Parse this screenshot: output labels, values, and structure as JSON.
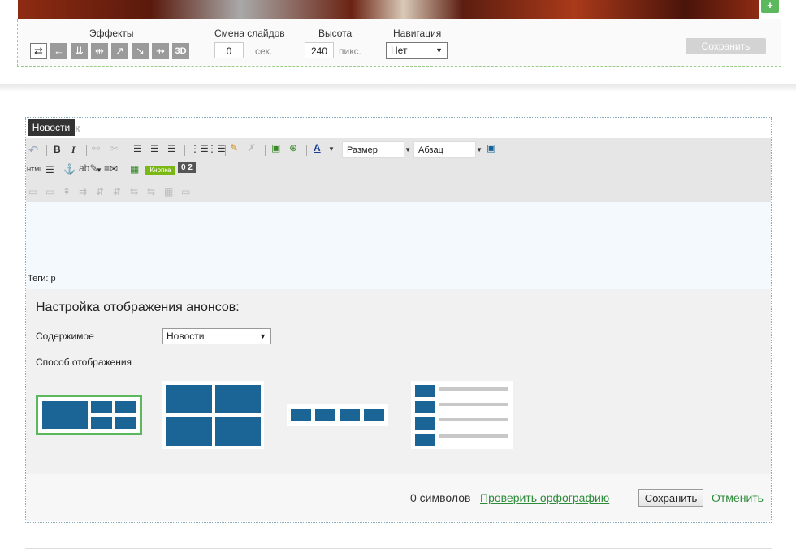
{
  "slider": {
    "add_button": "+",
    "effects_label": "Эффекты",
    "effects_icons": [
      "⇄",
      "←",
      "⇊",
      "⇹",
      "↗",
      "↘",
      "⇸",
      "3D"
    ],
    "slide_change_label": "Смена слайдов",
    "slide_change_value": "0",
    "slide_change_unit": "сек.",
    "height_label": "Высота",
    "height_value": "240",
    "height_unit": "пикс.",
    "nav_label": "Навигация",
    "nav_value": "Нет",
    "save_label": "Сохранить"
  },
  "editor": {
    "tooltip": "Новости",
    "ghost_title": "ок",
    "bold": "B",
    "italic": "I",
    "font_color_letter": "A",
    "size_combo": "Размер",
    "format_combo": "Абзац",
    "html_label": "HTML",
    "knopka_label": "Кнопка",
    "badge_label": "0 2",
    "tags": "Теги: p"
  },
  "settings": {
    "title": "Настройка отображения анонсов:",
    "content_label": "Содержимое",
    "content_value": "Новости",
    "mode_label": "Способ отображения",
    "selected_mode": 0
  },
  "footer": {
    "chars": "0 символов",
    "spell": "Проверить орфографию",
    "save": "Сохранить",
    "cancel": "Отменить"
  },
  "colors": {
    "accent_green": "#5cb85c",
    "tile_blue": "#1a6496",
    "link_green": "#2e8b3a"
  }
}
